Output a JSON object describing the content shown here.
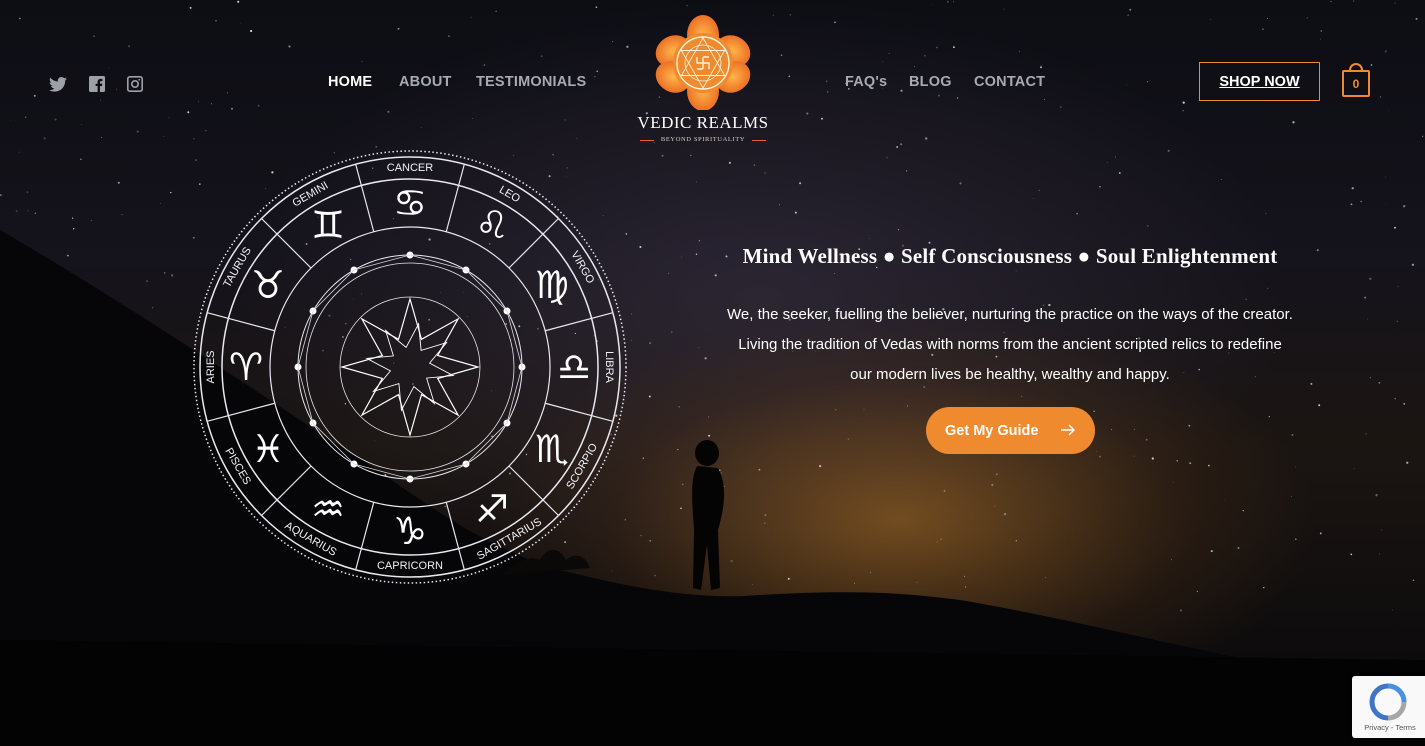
{
  "social": {
    "icons": [
      "twitter-icon",
      "facebook-icon",
      "instagram-icon"
    ]
  },
  "nav": {
    "left": [
      "HOME",
      "ABOUT",
      "TESTIMONIALS"
    ],
    "right": [
      "FAQ's",
      "BLOG",
      "CONTACT"
    ],
    "active": "HOME"
  },
  "logo": {
    "title": "VEDIC REALMS",
    "subtitle": "BEYOND SPIRITUALITY"
  },
  "header": {
    "shop_label": "SHOP NOW",
    "cart_count": "0"
  },
  "zodiac": {
    "signs": [
      "CANCER",
      "LEO",
      "VIRGO",
      "LIBRA",
      "SCORPIO",
      "SAGITTARIUS",
      "CAPRICORN",
      "AQUARIUS",
      "PISCES",
      "ARIES",
      "TAURUS",
      "GEMINI"
    ],
    "symbols": [
      "♋",
      "♌",
      "♍",
      "♎",
      "♏",
      "♐",
      "♑",
      "♒",
      "♓",
      "♈",
      "♉",
      "♊"
    ]
  },
  "hero": {
    "headline": "Mind Wellness ● Self Consciousness ● Soul Enlightenment",
    "description_lines": [
      "We, the seeker, fuelling the believer, nurturing the practice on the ways of the creator.",
      "Living the tradition of Vedas with norms from the ancient scripted relics to redefine",
      "our modern lives be healthy, wealthy and happy."
    ],
    "cta_label": "Get My Guide"
  },
  "recaptcha": {
    "links": "Privacy - Terms"
  },
  "colors": {
    "accent": "#ef8a2f",
    "nav_inactive": "#a8aab3",
    "text": "#ffffff"
  }
}
